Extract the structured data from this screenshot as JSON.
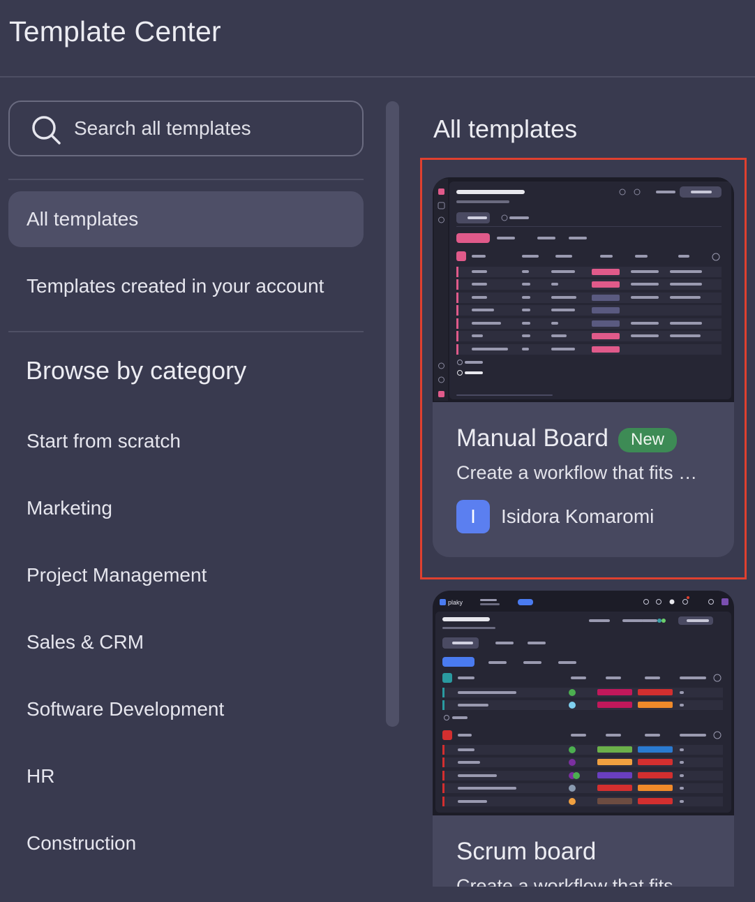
{
  "app": {
    "title": "Template Center"
  },
  "sidebar": {
    "search": {
      "placeholder": "Search all templates",
      "value": ""
    },
    "nav": [
      {
        "label": "All templates",
        "active": true
      },
      {
        "label": "Templates created in your account",
        "active": false
      }
    ],
    "category_title": "Browse by category",
    "categories": [
      "Start from scratch",
      "Marketing",
      "Project Management",
      "Sales & CRM",
      "Software Development",
      "HR",
      "Construction"
    ]
  },
  "main": {
    "title": "All templates",
    "cards": [
      {
        "title": "Manual Board",
        "badge": "New",
        "description": "Create a workflow that fits …",
        "author_initial": "I",
        "author": "Isidora Komaromi"
      },
      {
        "title": "Scrum board",
        "description": "Create a workflow that fits ..."
      }
    ],
    "thumb_logo": "plaky"
  },
  "colors": {
    "background": "#393a4f",
    "card": "#47485f",
    "highlight": "#e0402f",
    "badge": "#3d8b55",
    "avatar": "#5b7ff0"
  }
}
